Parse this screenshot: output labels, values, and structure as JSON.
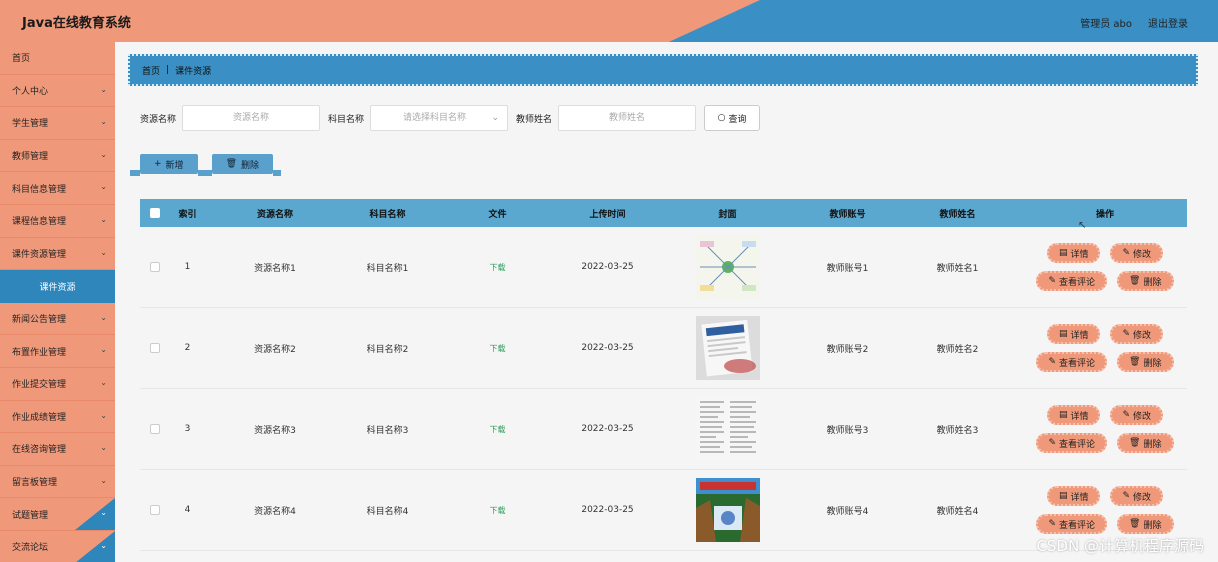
{
  "header": {
    "title": "Java在线教育系统",
    "user": "管理员 abo",
    "logout": "退出登录"
  },
  "sidebar": {
    "items": [
      {
        "label": "首页",
        "has_chevron": false
      },
      {
        "label": "个人中心",
        "has_chevron": true
      },
      {
        "label": "学生管理",
        "has_chevron": true
      },
      {
        "label": "教师管理",
        "has_chevron": true
      },
      {
        "label": "科目信息管理",
        "has_chevron": true
      },
      {
        "label": "课程信息管理",
        "has_chevron": true
      },
      {
        "label": "课件资源管理",
        "has_chevron": true
      },
      {
        "label": "课件资源",
        "active": true
      },
      {
        "label": "新闻公告管理",
        "has_chevron": true
      },
      {
        "label": "布置作业管理",
        "has_chevron": true
      },
      {
        "label": "作业提交管理",
        "has_chevron": true
      },
      {
        "label": "作业成绩管理",
        "has_chevron": true
      },
      {
        "label": "在线咨询管理",
        "has_chevron": true
      },
      {
        "label": "留言板管理",
        "has_chevron": true
      },
      {
        "label": "试题管理",
        "has_chevron": true
      },
      {
        "label": "交流论坛",
        "has_chevron": true
      }
    ]
  },
  "breadcrumb": {
    "home": "首页",
    "sep": "|",
    "current": "课件资源"
  },
  "search": {
    "resource_label": "资源名称",
    "resource_placeholder": "资源名称",
    "subject_label": "科目名称",
    "subject_placeholder": "请选择科目名称",
    "teacher_label": "教师姓名",
    "teacher_placeholder": "教师姓名",
    "query_label": "查询"
  },
  "actions": {
    "add": "新增",
    "delete": "删除"
  },
  "table": {
    "headers": [
      "索引",
      "资源名称",
      "科目名称",
      "文件",
      "上传时间",
      "封面",
      "教师账号",
      "教师姓名",
      "操作"
    ],
    "rows": [
      {
        "idx": "1",
        "name": "资源名称1",
        "subject": "科目名称1",
        "file": "下载",
        "time": "2022-03-25",
        "account": "教师账号1",
        "teacher": "教师姓名1"
      },
      {
        "idx": "2",
        "name": "资源名称2",
        "subject": "科目名称2",
        "file": "下载",
        "time": "2022-03-25",
        "account": "教师账号2",
        "teacher": "教师姓名2"
      },
      {
        "idx": "3",
        "name": "资源名称3",
        "subject": "科目名称3",
        "file": "下载",
        "time": "2022-03-25",
        "account": "教师账号3",
        "teacher": "教师姓名3"
      },
      {
        "idx": "4",
        "name": "资源名称4",
        "subject": "科目名称4",
        "file": "下载",
        "time": "2022-03-25",
        "account": "教师账号4",
        "teacher": "教师姓名4"
      }
    ],
    "ops": {
      "detail": "详情",
      "edit": "修改",
      "comments": "查看评论",
      "delete": "删除"
    }
  },
  "watermark": "CSDN @计算机程序源码",
  "colors": {
    "accent_orange": "#f0997a",
    "accent_blue": "#3a8fc4"
  }
}
